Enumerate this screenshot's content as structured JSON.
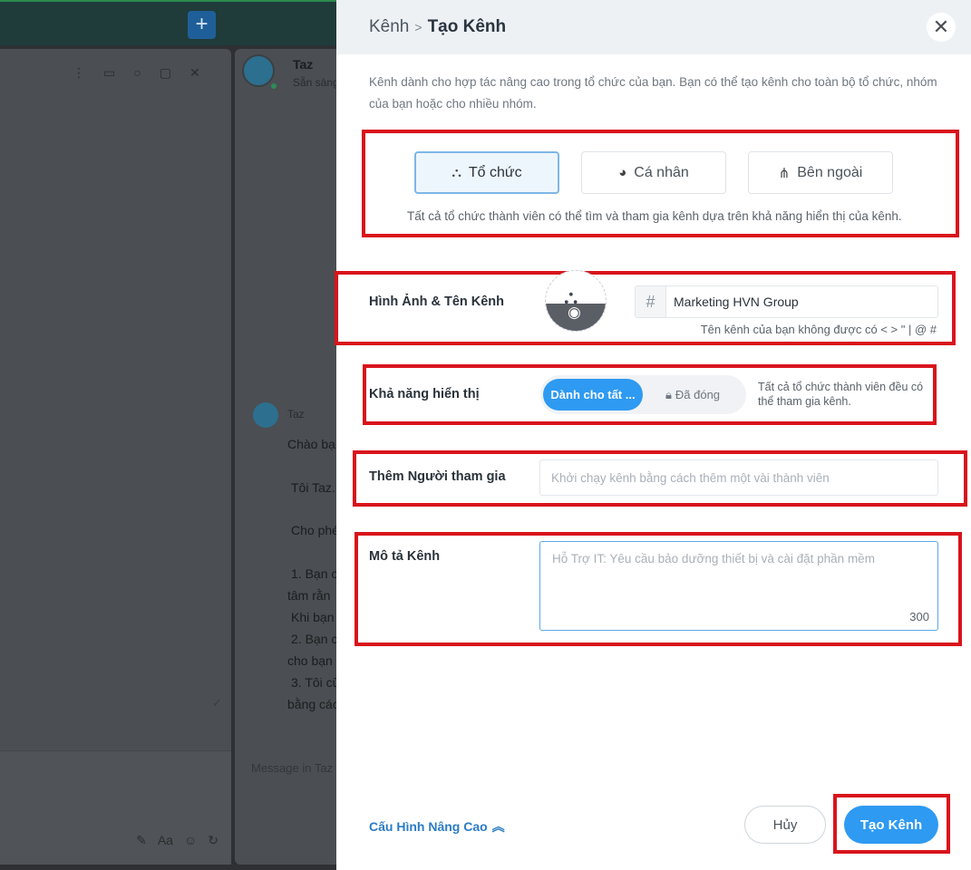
{
  "background": {
    "contact_name": "Taz",
    "contact_status": "Sẵn sàng",
    "message_sender": "Taz",
    "message_lines": [
      "Chào bạ",
      "Tôi Taz.",
      "Cho phé",
      "1. Bạn c",
      "tâm rằn",
      "Khi bạn",
      "2. Bạn c",
      "cho bạn",
      "3. Tôi cũ",
      "bằng các"
    ],
    "message_placeholder": "Message in Taz",
    "plus_label": "+"
  },
  "dialog": {
    "breadcrumb_parent": "Kênh",
    "breadcrumb_sep": ">",
    "title": "Tạo Kênh",
    "intro_text": "Kênh dành cho hợp tác nâng cao trong tổ chức của bạn. Bạn có thể tạo kênh cho toàn bộ tổ chức, nhóm của bạn hoặc cho nhiều nhóm.",
    "channel_types": [
      {
        "label": "Tổ chức",
        "icon": "org-chart-icon",
        "selected": true
      },
      {
        "label": "Cá nhân",
        "icon": "personal-icon",
        "selected": false
      },
      {
        "label": "Bên ngoài",
        "icon": "share-icon",
        "selected": false
      }
    ],
    "channel_type_desc": "Tất cả tổ chức thành viên có thể tìm và tham gia kênh dựa trên khả năng hiển thị của kênh.",
    "image_name_label": "Hình Ảnh & Tên Kênh",
    "channel_name_value": "Marketing HVN Group",
    "channel_name_hint": "Tên kênh của bạn không được có < > \" | @ #",
    "visibility_label": "Khả năng hiển thị",
    "visibility_on": "Dành cho tất ...",
    "visibility_off": "Đã đóng",
    "visibility_desc": "Tất cả tổ chức thành viên đều có thể tham gia kênh.",
    "members_label": "Thêm Người tham gia",
    "members_placeholder": "Khởi chạy kênh bằng cách thêm một vài thành viên",
    "description_label": "Mô tả Kênh",
    "description_placeholder": "Hỗ Trợ IT: Yêu cầu bảo dưỡng thiết bị và cài đặt phần mềm",
    "description_counter": "300",
    "advanced_link": "Cấu Hình Nâng Cao",
    "cancel_label": "Hủy",
    "create_label": "Tạo Kênh"
  },
  "colors": {
    "accent": "#2e9af2",
    "highlight_border": "#d9141c",
    "link": "#2b7cc4"
  }
}
